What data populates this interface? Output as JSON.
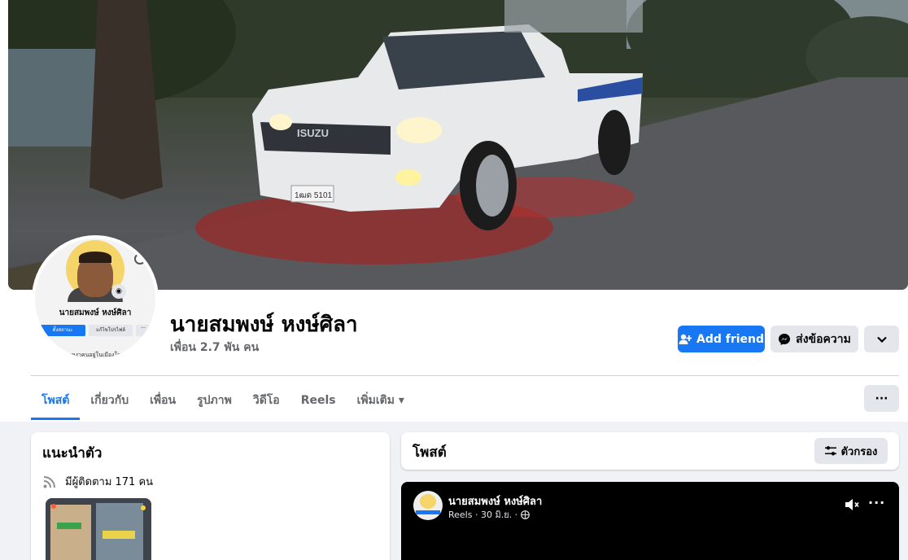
{
  "profile": {
    "name": "นายสมพงษ์ หงษ์ศิลา",
    "friends": "เพื่อน 2.7 พัน คน",
    "avatar_mini": {
      "name": "นายสมพงษ์ หงษ์ศิลา",
      "btn_primary": "ตั้งสถานะ",
      "btn_secondary": "แก้ไขโปรไฟล์",
      "btn_more": "···",
      "bio": "เหงาคนอยู่ในเมืองใด"
    }
  },
  "actions": {
    "add_friend": "Add friend",
    "message": "ส่งข้อความ",
    "more": "⌄"
  },
  "tabs": [
    {
      "label": "โพสต์",
      "active": true
    },
    {
      "label": "เกี่ยวกับ",
      "active": false
    },
    {
      "label": "เพื่อน",
      "active": false
    },
    {
      "label": "รูปภาพ",
      "active": false
    },
    {
      "label": "วิดีโอ",
      "active": false
    },
    {
      "label": "Reels",
      "active": false
    },
    {
      "label": "เพิ่มเติม ▾",
      "active": false
    }
  ],
  "tabs_more": "···",
  "intro": {
    "title": "แนะนำตัว",
    "followers": "มีผู้ติดตาม 171 คน"
  },
  "posts": {
    "title": "โพสต์",
    "filter": "ตัวกรอง"
  },
  "reel": {
    "author": "นายสมพงษ์ หงษ์ศิลา",
    "meta": "Reels · 30 มิ.ย. ·",
    "more": "···"
  },
  "cover": {
    "plate": "1ฒด 5101",
    "brand": "ISUZU"
  },
  "colors": {
    "accent": "#1877f2",
    "page_bg": "#f0f2f5",
    "button_grey": "#e4e6eb"
  }
}
